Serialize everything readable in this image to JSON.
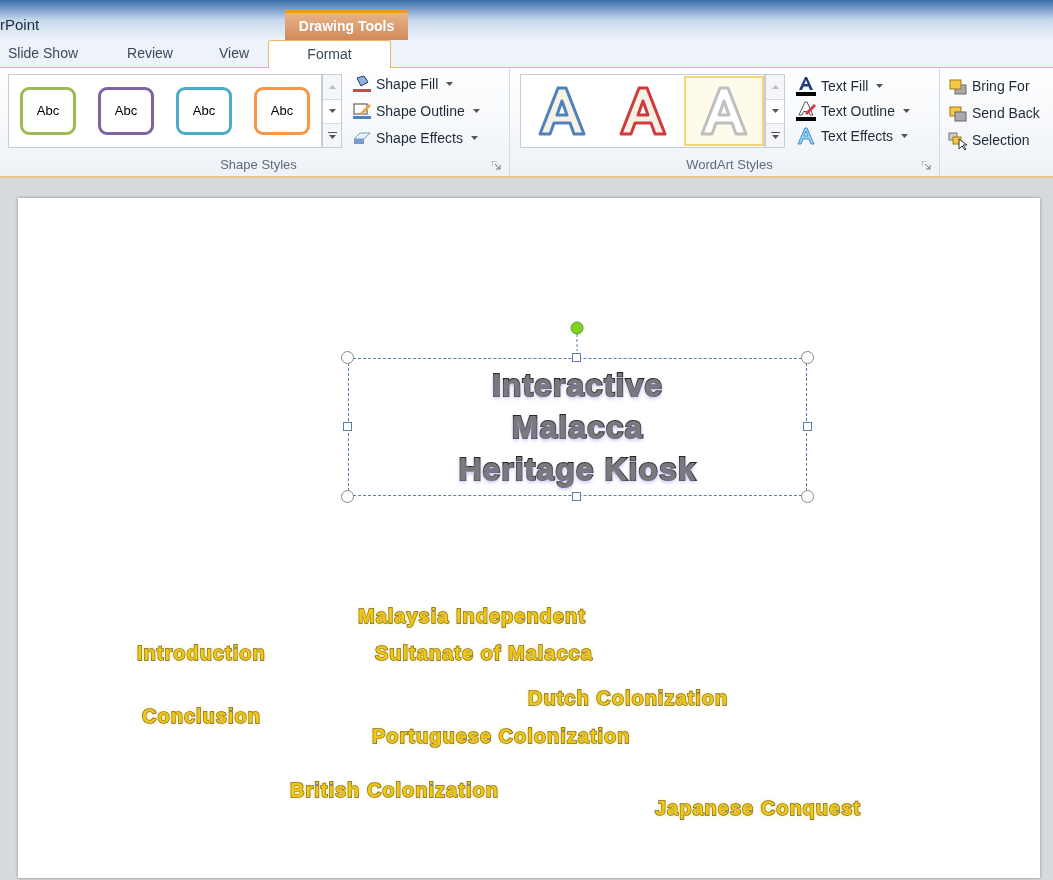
{
  "window": {
    "title": "rPoint"
  },
  "contextual_tab_group": "Drawing Tools",
  "tabs": [
    {
      "label": "Slide Show",
      "selected": false
    },
    {
      "label": "Review",
      "selected": false
    },
    {
      "label": "View",
      "selected": false
    },
    {
      "label": "Format",
      "selected": true
    }
  ],
  "shape_styles": {
    "label": "Shape Styles",
    "items": [
      {
        "label": "Abc",
        "color": "#9bbb59"
      },
      {
        "label": "Abc",
        "color": "#8064a2"
      },
      {
        "label": "Abc",
        "color": "#4bacc6"
      },
      {
        "label": "Abc",
        "color": "#f79646"
      }
    ],
    "commands": [
      {
        "kind": "fill",
        "label": "Shape Fill"
      },
      {
        "kind": "outline",
        "label": "Shape Outline"
      },
      {
        "kind": "effects",
        "label": "Shape Effects"
      }
    ]
  },
  "wordart_styles": {
    "label": "WordArt Styles",
    "items": [
      {
        "color": "#4f81bd",
        "selected": false
      },
      {
        "color": "#d03a3a",
        "selected": false
      },
      {
        "color": "#bfbfbf",
        "selected": true
      }
    ],
    "commands": [
      {
        "kind": "fill",
        "label": "Text Fill"
      },
      {
        "kind": "outline",
        "label": "Text Outline"
      },
      {
        "kind": "effects",
        "label": "Text Effects"
      }
    ]
  },
  "arrange": {
    "commands": [
      {
        "kind": "forward",
        "label": "Bring For"
      },
      {
        "kind": "backward",
        "label": "Send Back"
      },
      {
        "kind": "selection",
        "label": "Selection"
      }
    ]
  },
  "slide": {
    "title_box": {
      "selected": true,
      "lines": [
        "Interactive",
        "Malacca",
        "Heritage Kiosk"
      ]
    },
    "labels": [
      "Malaysia Independent",
      "Introduction",
      "Sultanate of Malacca",
      "Dutch Colonization",
      "Conclusion",
      "Portuguese Colonization",
      "British Colonization",
      "Japanese Conquest"
    ]
  }
}
